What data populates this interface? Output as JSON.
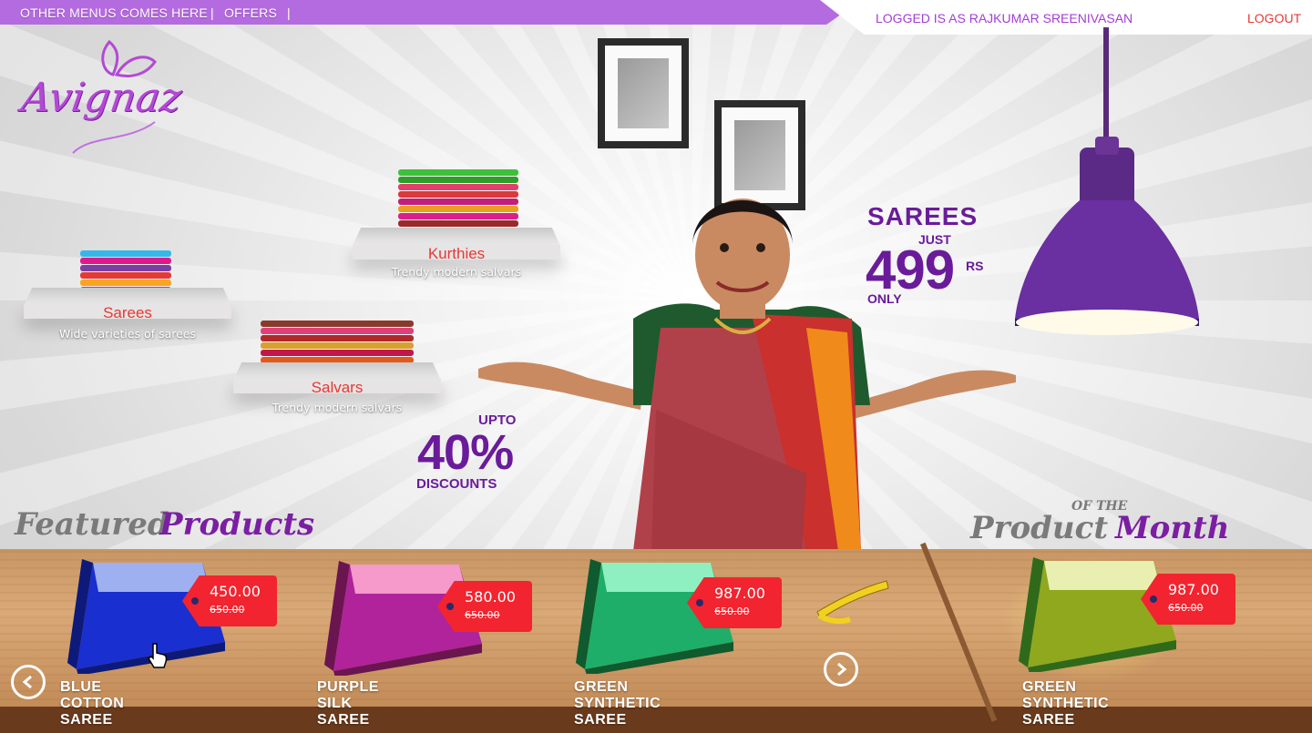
{
  "topbar": {
    "menu_label": "OTHER MENUS COMES HERE",
    "offers_label": "OFFERS",
    "separator": "|"
  },
  "userbar": {
    "logged_in_text": "LOGGED IS AS RAJKUMAR SREENIVASAN",
    "logout_label": "LOGOUT"
  },
  "brand": {
    "logo_text": "Avignaz"
  },
  "categories": [
    {
      "title": "Sarees",
      "description": "Wide varieties of sarees"
    },
    {
      "title": "Kurthies",
      "description": "Trendy modern salvars"
    },
    {
      "title": "Salvars",
      "description": "Trendy modern salvars"
    }
  ],
  "promo_sarees": {
    "heading": "SAREES",
    "just": "JUST",
    "price": "499",
    "unit": "RS",
    "only": "ONLY"
  },
  "promo_discount": {
    "upto": "UPTO",
    "percent": "40%",
    "label": "DISCOUNTS"
  },
  "featured": {
    "heading_part1": "Featured",
    "heading_part2": "Products",
    "items": [
      {
        "name": "BLUE COTTON SAREE",
        "price": "450.00",
        "old_price": "650.00",
        "color": "#1a2fd0",
        "top_color": "#9fb0f0",
        "border_color": "#0d1a7a"
      },
      {
        "name": "PURPLE SILK SAREE",
        "price": "580.00",
        "old_price": "650.00",
        "color": "#b0239a",
        "top_color": "#f59acb",
        "border_color": "#6a1550"
      },
      {
        "name": "GREEN SYNTHETIC SAREE",
        "price": "987.00",
        "old_price": "650.00",
        "color": "#1fae6a",
        "top_color": "#8ef0c0",
        "border_color": "#0f5a2e"
      }
    ]
  },
  "product_of_month": {
    "heading_small": "OF THE",
    "heading_part1": "Product",
    "heading_part2": "Month",
    "item": {
      "name": "GREEN SYNTHETIC SAREE",
      "price": "987.00",
      "old_price": "650.00",
      "color": "#8fa81e",
      "top_color": "#e9efb0",
      "border_color": "#2f6a1a"
    }
  },
  "colors": {
    "accent": "#a33cd6",
    "logout": "#e53935",
    "tag": "#f2242f",
    "promo": "#6a1b9a"
  }
}
